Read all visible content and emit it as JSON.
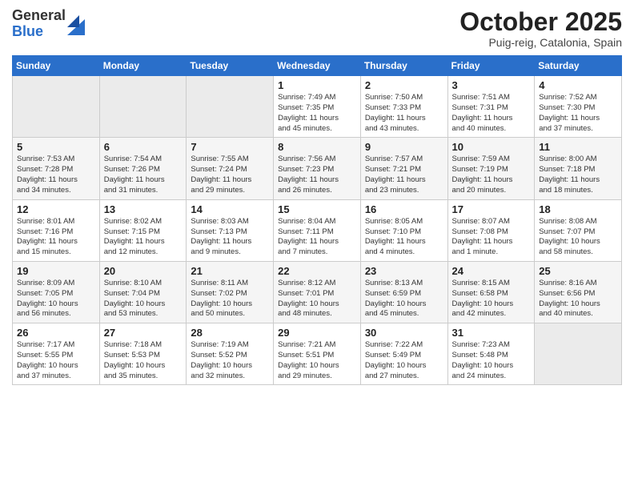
{
  "header": {
    "logo": {
      "general": "General",
      "blue": "Blue"
    },
    "title": "October 2025",
    "location": "Puig-reig, Catalonia, Spain"
  },
  "weekdays": [
    "Sunday",
    "Monday",
    "Tuesday",
    "Wednesday",
    "Thursday",
    "Friday",
    "Saturday"
  ],
  "weeks": [
    [
      {
        "num": "",
        "detail": ""
      },
      {
        "num": "",
        "detail": ""
      },
      {
        "num": "",
        "detail": ""
      },
      {
        "num": "1",
        "detail": "Sunrise: 7:49 AM\nSunset: 7:35 PM\nDaylight: 11 hours\nand 45 minutes."
      },
      {
        "num": "2",
        "detail": "Sunrise: 7:50 AM\nSunset: 7:33 PM\nDaylight: 11 hours\nand 43 minutes."
      },
      {
        "num": "3",
        "detail": "Sunrise: 7:51 AM\nSunset: 7:31 PM\nDaylight: 11 hours\nand 40 minutes."
      },
      {
        "num": "4",
        "detail": "Sunrise: 7:52 AM\nSunset: 7:30 PM\nDaylight: 11 hours\nand 37 minutes."
      }
    ],
    [
      {
        "num": "5",
        "detail": "Sunrise: 7:53 AM\nSunset: 7:28 PM\nDaylight: 11 hours\nand 34 minutes."
      },
      {
        "num": "6",
        "detail": "Sunrise: 7:54 AM\nSunset: 7:26 PM\nDaylight: 11 hours\nand 31 minutes."
      },
      {
        "num": "7",
        "detail": "Sunrise: 7:55 AM\nSunset: 7:24 PM\nDaylight: 11 hours\nand 29 minutes."
      },
      {
        "num": "8",
        "detail": "Sunrise: 7:56 AM\nSunset: 7:23 PM\nDaylight: 11 hours\nand 26 minutes."
      },
      {
        "num": "9",
        "detail": "Sunrise: 7:57 AM\nSunset: 7:21 PM\nDaylight: 11 hours\nand 23 minutes."
      },
      {
        "num": "10",
        "detail": "Sunrise: 7:59 AM\nSunset: 7:19 PM\nDaylight: 11 hours\nand 20 minutes."
      },
      {
        "num": "11",
        "detail": "Sunrise: 8:00 AM\nSunset: 7:18 PM\nDaylight: 11 hours\nand 18 minutes."
      }
    ],
    [
      {
        "num": "12",
        "detail": "Sunrise: 8:01 AM\nSunset: 7:16 PM\nDaylight: 11 hours\nand 15 minutes."
      },
      {
        "num": "13",
        "detail": "Sunrise: 8:02 AM\nSunset: 7:15 PM\nDaylight: 11 hours\nand 12 minutes."
      },
      {
        "num": "14",
        "detail": "Sunrise: 8:03 AM\nSunset: 7:13 PM\nDaylight: 11 hours\nand 9 minutes."
      },
      {
        "num": "15",
        "detail": "Sunrise: 8:04 AM\nSunset: 7:11 PM\nDaylight: 11 hours\nand 7 minutes."
      },
      {
        "num": "16",
        "detail": "Sunrise: 8:05 AM\nSunset: 7:10 PM\nDaylight: 11 hours\nand 4 minutes."
      },
      {
        "num": "17",
        "detail": "Sunrise: 8:07 AM\nSunset: 7:08 PM\nDaylight: 11 hours\nand 1 minute."
      },
      {
        "num": "18",
        "detail": "Sunrise: 8:08 AM\nSunset: 7:07 PM\nDaylight: 10 hours\nand 58 minutes."
      }
    ],
    [
      {
        "num": "19",
        "detail": "Sunrise: 8:09 AM\nSunset: 7:05 PM\nDaylight: 10 hours\nand 56 minutes."
      },
      {
        "num": "20",
        "detail": "Sunrise: 8:10 AM\nSunset: 7:04 PM\nDaylight: 10 hours\nand 53 minutes."
      },
      {
        "num": "21",
        "detail": "Sunrise: 8:11 AM\nSunset: 7:02 PM\nDaylight: 10 hours\nand 50 minutes."
      },
      {
        "num": "22",
        "detail": "Sunrise: 8:12 AM\nSunset: 7:01 PM\nDaylight: 10 hours\nand 48 minutes."
      },
      {
        "num": "23",
        "detail": "Sunrise: 8:13 AM\nSunset: 6:59 PM\nDaylight: 10 hours\nand 45 minutes."
      },
      {
        "num": "24",
        "detail": "Sunrise: 8:15 AM\nSunset: 6:58 PM\nDaylight: 10 hours\nand 42 minutes."
      },
      {
        "num": "25",
        "detail": "Sunrise: 8:16 AM\nSunset: 6:56 PM\nDaylight: 10 hours\nand 40 minutes."
      }
    ],
    [
      {
        "num": "26",
        "detail": "Sunrise: 7:17 AM\nSunset: 5:55 PM\nDaylight: 10 hours\nand 37 minutes."
      },
      {
        "num": "27",
        "detail": "Sunrise: 7:18 AM\nSunset: 5:53 PM\nDaylight: 10 hours\nand 35 minutes."
      },
      {
        "num": "28",
        "detail": "Sunrise: 7:19 AM\nSunset: 5:52 PM\nDaylight: 10 hours\nand 32 minutes."
      },
      {
        "num": "29",
        "detail": "Sunrise: 7:21 AM\nSunset: 5:51 PM\nDaylight: 10 hours\nand 29 minutes."
      },
      {
        "num": "30",
        "detail": "Sunrise: 7:22 AM\nSunset: 5:49 PM\nDaylight: 10 hours\nand 27 minutes."
      },
      {
        "num": "31",
        "detail": "Sunrise: 7:23 AM\nSunset: 5:48 PM\nDaylight: 10 hours\nand 24 minutes."
      },
      {
        "num": "",
        "detail": ""
      }
    ]
  ]
}
